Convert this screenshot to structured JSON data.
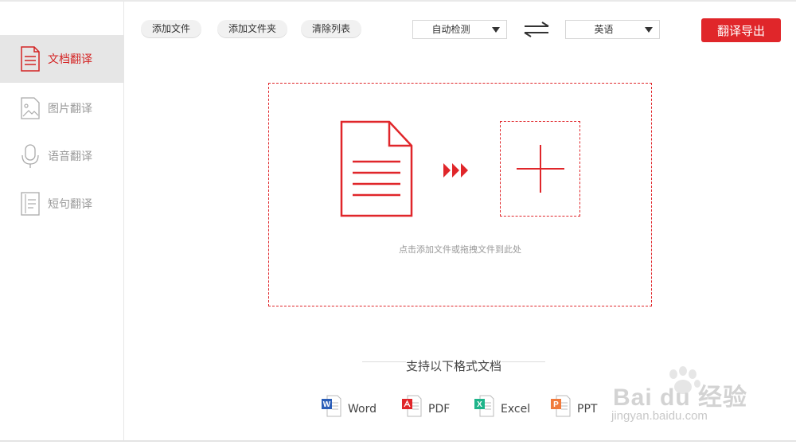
{
  "sidebar": {
    "items": [
      {
        "label": "文档翻译",
        "icon": "document-icon",
        "active": true
      },
      {
        "label": "图片翻译",
        "icon": "image-icon",
        "active": false
      },
      {
        "label": "语音翻译",
        "icon": "microphone-icon",
        "active": false
      },
      {
        "label": "短句翻译",
        "icon": "text-lines-icon",
        "active": false
      }
    ]
  },
  "toolbar": {
    "add_file": "添加文件",
    "add_folder": "添加文件夹",
    "clear_list": "清除列表",
    "source_lang": "自动检测",
    "target_lang": "英语",
    "export": "翻译导出"
  },
  "dropzone": {
    "hint": "点击添加文件或拖拽文件到此处"
  },
  "formats": {
    "title": "支持以下格式文档",
    "items": [
      {
        "label": "Word",
        "icon_letter": "W",
        "color": "#2b5eb8"
      },
      {
        "label": "PDF",
        "icon_letter": "",
        "color": "#e0262a"
      },
      {
        "label": "Excel",
        "icon_letter": "X",
        "color": "#1fb48a"
      },
      {
        "label": "PPT",
        "icon_letter": "P",
        "color": "#f07a3c"
      }
    ]
  },
  "watermark": {
    "brand": "Bai du 经验",
    "url": "jingyan.baidu.com"
  },
  "colors": {
    "accent": "#e0262a",
    "sidebar_active_bg": "#e6e6e6"
  }
}
